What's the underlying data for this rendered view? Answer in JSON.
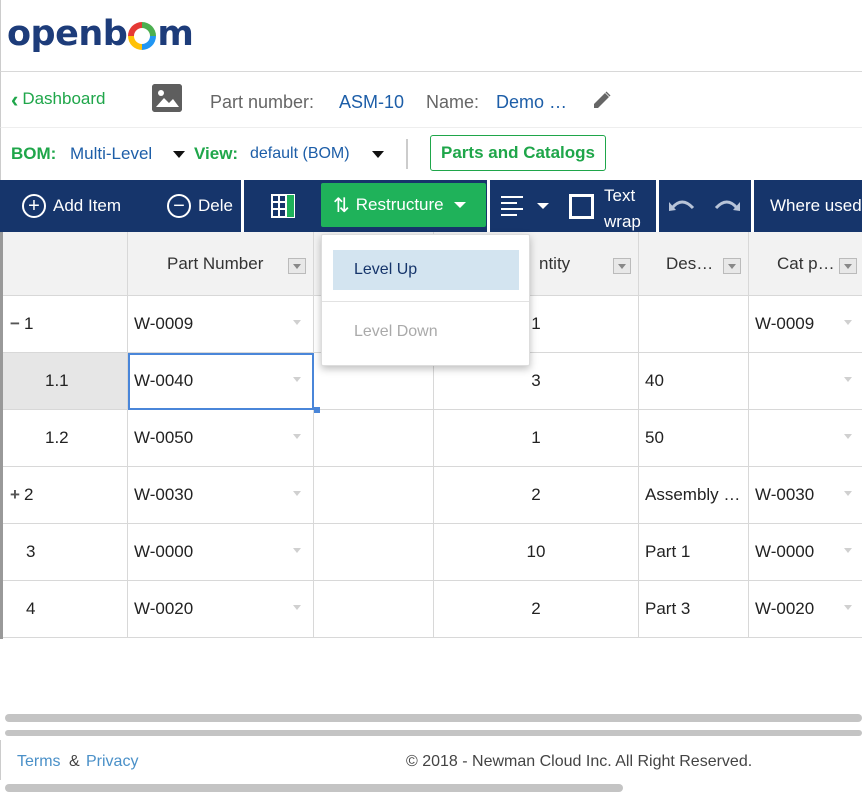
{
  "logo": {
    "text_a": "openb",
    "text_b": "m"
  },
  "breadcrumb": {
    "back_label": "Dashboard",
    "part_number_label": "Part number:",
    "part_number_value": "ASM-10",
    "name_label": "Name:",
    "name_value": "Demo …"
  },
  "bom_bar": {
    "bom_label": "BOM:",
    "bom_value": "Multi-Level",
    "view_label": "View:",
    "view_value": "default (BOM)",
    "parts_catalogs_label": "Parts and Catalogs"
  },
  "toolbar": {
    "add_item_label": "Add Item",
    "delete_label": "Dele",
    "restructure_label": "Restructure",
    "text_wrap_line1": "Text",
    "text_wrap_line2": "wrap",
    "where_used_label": "Where used"
  },
  "restructure_menu": {
    "items": [
      {
        "label": "Level Up",
        "state": "hover"
      },
      {
        "label": "Level Down",
        "state": "disabled"
      }
    ]
  },
  "grid": {
    "columns": [
      "",
      "Part Number",
      "",
      "ntity",
      "Des…",
      "Cat p…"
    ],
    "rows": [
      {
        "expander": "−",
        "level": "1",
        "part_number": "W-0009",
        "col3": "",
        "quantity": "1",
        "description": "",
        "catalog_part": "W-0009"
      },
      {
        "expander": "",
        "level": "1.1",
        "part_number": "W-0040",
        "col3": "",
        "quantity": "3",
        "description": "40",
        "catalog_part": ""
      },
      {
        "expander": "",
        "level": "1.2",
        "part_number": "W-0050",
        "col3": "",
        "quantity": "1",
        "description": "50",
        "catalog_part": ""
      },
      {
        "expander": "+",
        "level": "2",
        "part_number": "W-0030",
        "col3": "",
        "quantity": "2",
        "description": "Assembly …",
        "catalog_part": "W-0030"
      },
      {
        "expander": "",
        "level": "3",
        "part_number": "W-0000",
        "col3": "",
        "quantity": "10",
        "description": "Part 1",
        "catalog_part": "W-0000"
      },
      {
        "expander": "",
        "level": "4",
        "part_number": "W-0020",
        "col3": "",
        "quantity": "2",
        "description": "Part 3",
        "catalog_part": "W-0020"
      }
    ]
  },
  "footer": {
    "terms": "Terms",
    "amp": "&",
    "privacy": "Privacy",
    "copyright": "© 2018 - Newman Cloud Inc. All Right Reserved."
  },
  "colors": {
    "brand_green": "#1fa64a",
    "toolbar_navy": "#16356b",
    "link_blue": "#1d5ea8",
    "menu_hover": "#d3e4f0"
  }
}
